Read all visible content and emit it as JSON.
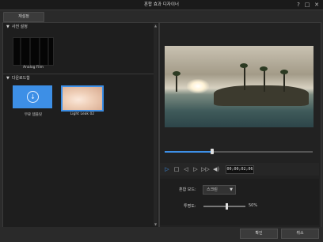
{
  "window": {
    "title": "혼합 효과 디자이너",
    "help_icon": "?",
    "restore_icon": "□",
    "close_icon": "✕"
  },
  "toolbar": {
    "reset_label": "재설정"
  },
  "left_panel": {
    "preset_section": {
      "title": "사전 설정",
      "items": [
        {
          "label": "Analog Film"
        }
      ]
    },
    "download_section": {
      "title": "다운로드함",
      "items": [
        {
          "label": "무료 템플릿"
        },
        {
          "label": "Light Leak 02"
        }
      ]
    }
  },
  "player": {
    "progress": 0.32,
    "timecode": "00;00;02;06"
  },
  "properties": {
    "blend_mode_label": "혼합 모드:",
    "blend_mode_value": "스크린",
    "opacity_label": "투명도:",
    "opacity_value": "50%"
  },
  "footer": {
    "ok_label": "확인",
    "cancel_label": "취소"
  },
  "colors": {
    "accent": "#3d8fe6",
    "background": "#2b2b2b",
    "panel": "#1e1e1e"
  }
}
